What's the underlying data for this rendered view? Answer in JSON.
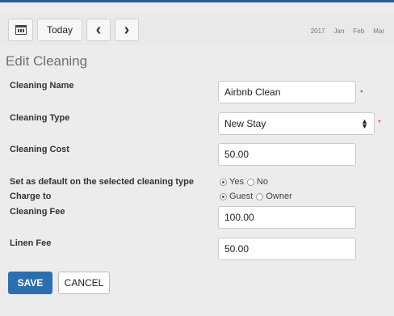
{
  "toolbar": {
    "today_label": "Today",
    "prev_icon": "chevron-left-icon",
    "next_icon": "chevron-right-icon",
    "calendar_icon": "calendar-icon",
    "year": "2017",
    "months": [
      "Jan",
      "Feb",
      "Mar"
    ]
  },
  "form": {
    "title": "Edit Cleaning",
    "cleaning_name": {
      "label": "Cleaning Name",
      "value": "Airbnb Clean",
      "required": "*"
    },
    "cleaning_type": {
      "label": "Cleaning Type",
      "value": "New Stay",
      "required": "*"
    },
    "cleaning_cost": {
      "label": "Cleaning Cost",
      "value": "50.00"
    },
    "default_type": {
      "label": "Set as default on the selected cleaning type",
      "options": [
        "Yes",
        "No"
      ],
      "selected": "Yes"
    },
    "charge_to": {
      "label": "Charge to",
      "options": [
        "Guest",
        "Owner"
      ],
      "selected": "Guest"
    },
    "cleaning_fee": {
      "label": "Cleaning Fee",
      "value": "100.00"
    },
    "linen_fee": {
      "label": "Linen Fee",
      "value": "50.00"
    }
  },
  "actions": {
    "save_label": "SAVE",
    "cancel_label": "CANCEL"
  },
  "colors": {
    "accent": "#2b6fb0",
    "required": "#d32f2f",
    "top_bar": "#2c5f8f"
  }
}
